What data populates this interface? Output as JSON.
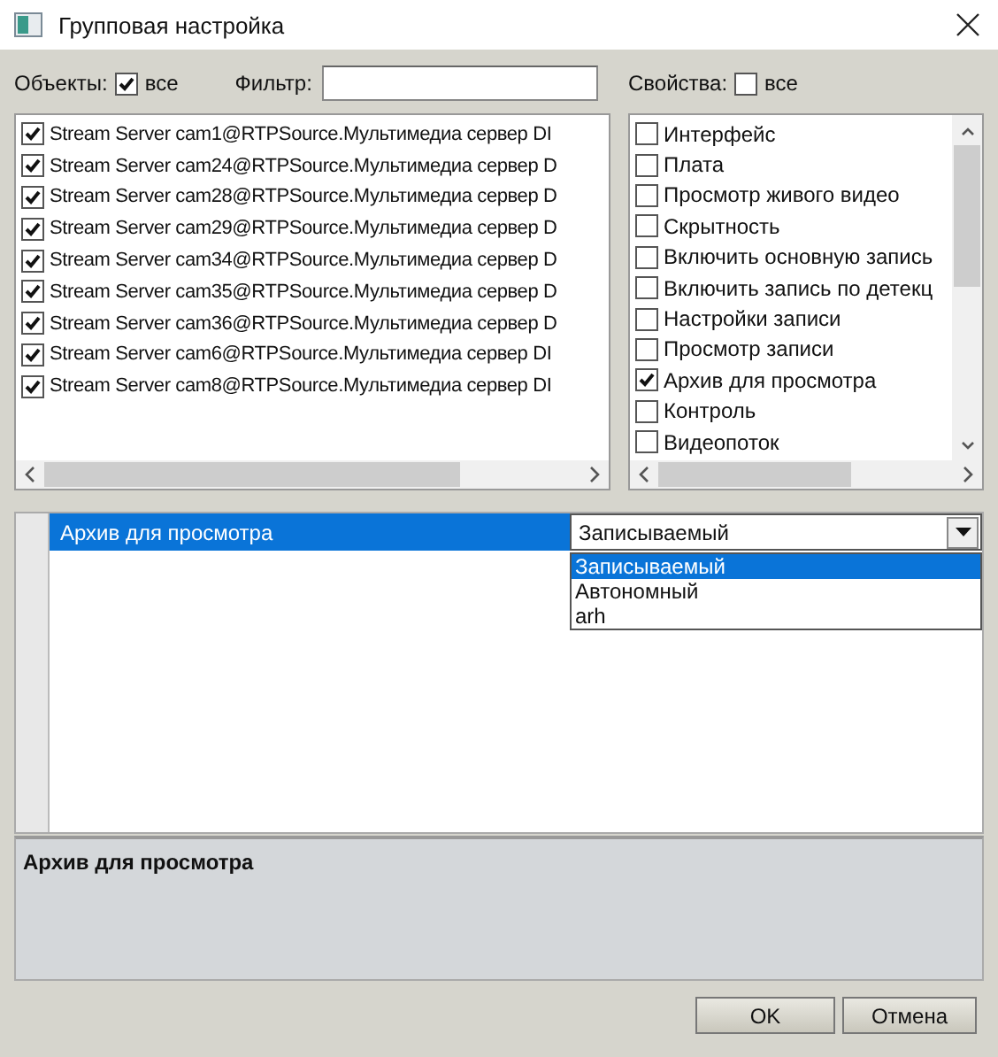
{
  "window": {
    "title": "Групповая настройка"
  },
  "objects": {
    "label": "Объекты:",
    "all_checked": true,
    "all_label": "все",
    "filter_label": "Фильтр:",
    "items": [
      {
        "text": "Stream Server cam1@RTPSource.Мультимедиа сервер DI",
        "checked": true
      },
      {
        "text": "Stream Server cam24@RTPSource.Мультимедиа сервер D",
        "checked": true
      },
      {
        "text": "Stream Server cam28@RTPSource.Мультимедиа сервер D",
        "checked": true
      },
      {
        "text": "Stream Server cam29@RTPSource.Мультимедиа сервер D",
        "checked": true
      },
      {
        "text": "Stream Server cam34@RTPSource.Мультимедиа сервер D",
        "checked": true
      },
      {
        "text": "Stream Server cam35@RTPSource.Мультимедиа сервер D",
        "checked": true
      },
      {
        "text": "Stream Server cam36@RTPSource.Мультимедиа сервер D",
        "checked": true
      },
      {
        "text": "Stream Server cam6@RTPSource.Мультимедиа сервер DI",
        "checked": true
      },
      {
        "text": "Stream Server cam8@RTPSource.Мультимедиа сервер DI",
        "checked": true
      }
    ]
  },
  "properties": {
    "label": "Свойства:",
    "all_checked": false,
    "all_label": "все",
    "items": [
      {
        "text": "Интерфейс",
        "checked": false
      },
      {
        "text": "Плата",
        "checked": false
      },
      {
        "text": "Просмотр живого видео",
        "checked": false
      },
      {
        "text": "Скрытность",
        "checked": false
      },
      {
        "text": "Включить основную запись",
        "checked": false
      },
      {
        "text": "Включить запись по детекц",
        "checked": false
      },
      {
        "text": "Настройки записи",
        "checked": false
      },
      {
        "text": "Просмотр записи",
        "checked": false
      },
      {
        "text": "Архив для просмотра",
        "checked": true
      },
      {
        "text": "Контроль",
        "checked": false
      },
      {
        "text": "Видеопоток",
        "checked": false
      }
    ]
  },
  "grid": {
    "property": "Архив для просмотра",
    "value": "Записываемый",
    "options": [
      {
        "text": "Записываемый",
        "selected": true
      },
      {
        "text": "Автономный",
        "selected": false
      },
      {
        "text": "arh",
        "selected": false
      }
    ]
  },
  "description": {
    "title": "Архив для просмотра"
  },
  "buttons": [
    "OK",
    "Отмена"
  ]
}
